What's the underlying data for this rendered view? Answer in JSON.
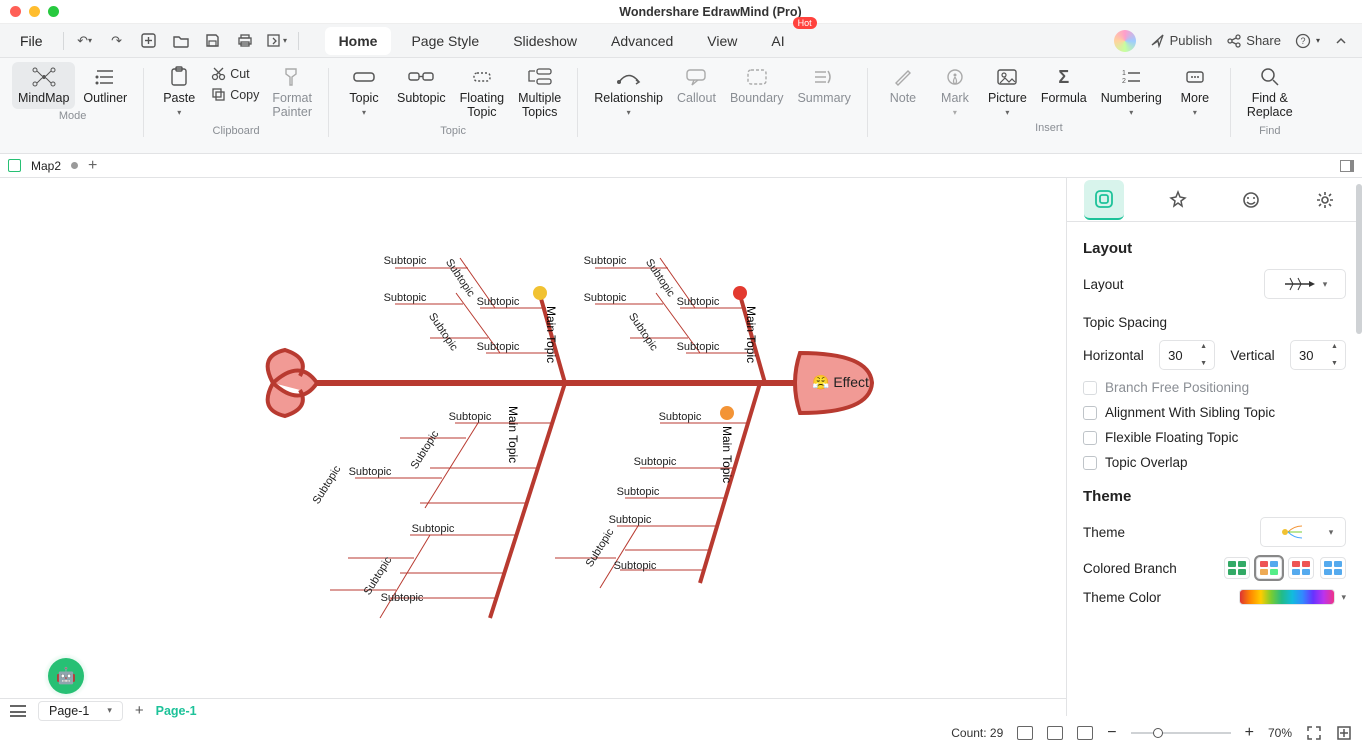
{
  "window": {
    "title": "Wondershare EdrawMind (Pro)"
  },
  "menu": {
    "file": "File",
    "tabs": [
      "Home",
      "Page Style",
      "Slideshow",
      "Advanced",
      "View",
      "AI"
    ],
    "active_tab": "Home",
    "ai_badge": "Hot",
    "publish": "Publish",
    "share": "Share"
  },
  "ribbon": {
    "mode_group": "Mode",
    "mindmap": "MindMap",
    "outliner": "Outliner",
    "clipboard_group": "Clipboard",
    "paste": "Paste",
    "cut": "Cut",
    "copy": "Copy",
    "format_painter": "Format\nPainter",
    "topic_group": "Topic",
    "topic": "Topic",
    "subtopic": "Subtopic",
    "floating_topic": "Floating\nTopic",
    "multiple_topics": "Multiple\nTopics",
    "insert_group": "Insert",
    "relationship": "Relationship",
    "callout": "Callout",
    "boundary": "Boundary",
    "summary": "Summary",
    "note": "Note",
    "mark": "Mark",
    "picture": "Picture",
    "formula": "Formula",
    "numbering": "Numbering",
    "more": "More",
    "find_group": "Find",
    "find_replace": "Find &\nReplace"
  },
  "doc": {
    "map_name": "Map2"
  },
  "diagram": {
    "effect": "Effect",
    "effect_emoji": "😤",
    "main_topic": "Main Topic",
    "subtopic": "Subtopic"
  },
  "sidepane": {
    "section_layout": "Layout",
    "layout_label": "Layout",
    "topic_spacing": "Topic Spacing",
    "horizontal": "Horizontal",
    "vertical": "Vertical",
    "h_val": "30",
    "v_val": "30",
    "branch_free": "Branch Free Positioning",
    "align_sibling": "Alignment With Sibling Topic",
    "flexible_floating": "Flexible Floating Topic",
    "topic_overlap": "Topic Overlap",
    "section_theme": "Theme",
    "theme_label": "Theme",
    "colored_branch": "Colored Branch",
    "theme_color": "Theme Color"
  },
  "pagebar": {
    "selector": "Page-1",
    "active": "Page-1"
  },
  "status": {
    "count": "Count: 29",
    "zoom": "70%"
  }
}
